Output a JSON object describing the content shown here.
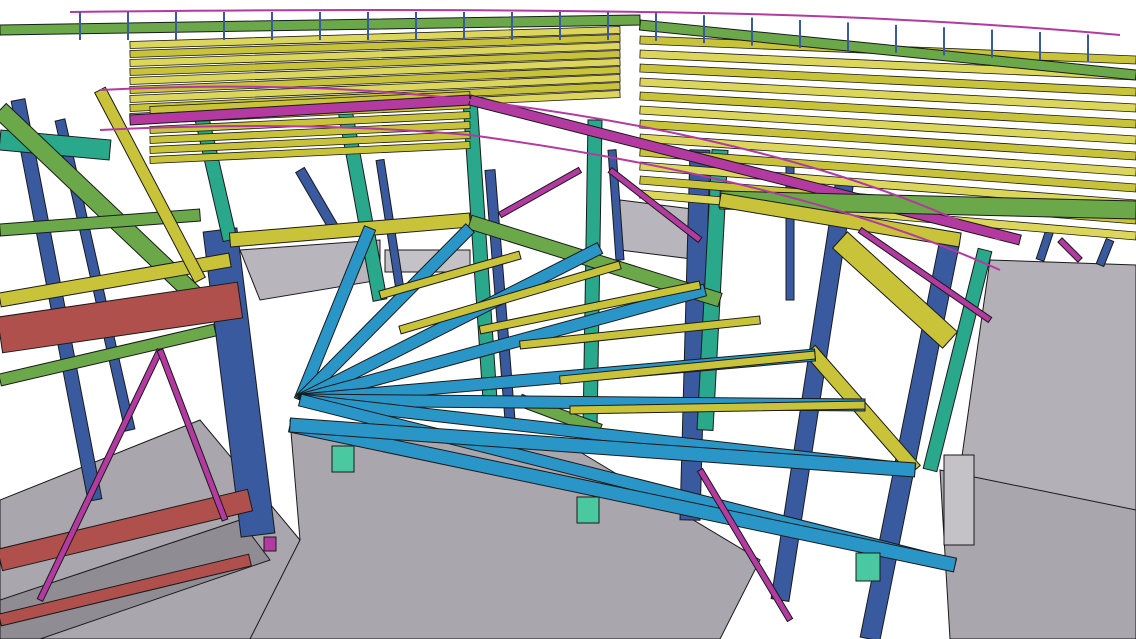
{
  "scene": {
    "kind": "3d-steel-structure-model-view",
    "colors": {
      "background": "#ffffff",
      "concrete": "#a9a6ad",
      "concrete_dark": "#8f8c93",
      "beam_yellow": "#c9c33a",
      "beam_yellow_light": "#dcd65a",
      "beam_blue": "#2a96c8",
      "column_navy": "#3a5aa0",
      "column_teal": "#2aa88c",
      "beam_green": "#6aa84a",
      "beam_magenta": "#b23aa0",
      "beam_red": "#b0504c",
      "connection_plate": "#4ac8a0",
      "outline": "#1a1a1a"
    }
  }
}
